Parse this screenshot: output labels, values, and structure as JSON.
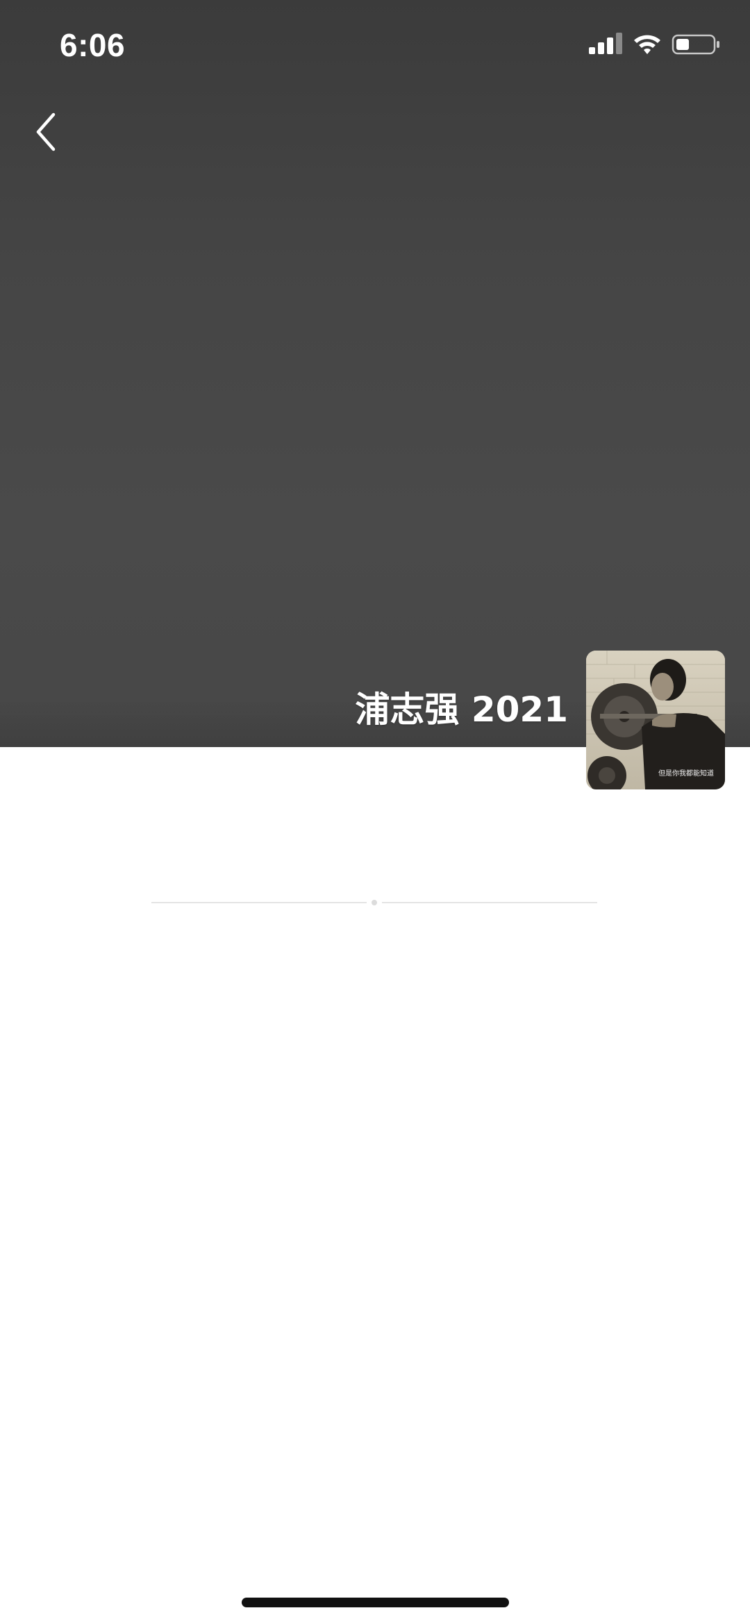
{
  "status_bar": {
    "time": "6:06",
    "icons": [
      "cellular-signal-icon",
      "wifi-icon",
      "battery-icon"
    ],
    "battery_level": 0.35
  },
  "navigation": {
    "back_icon": "chevron-left-icon"
  },
  "profile": {
    "name": "浦志强 2021",
    "avatar_caption": "但是你我都能知道"
  },
  "colors": {
    "cover_background": "#444444",
    "page_background": "#ffffff",
    "text_on_cover": "#ffffff",
    "divider": "#e4e4e4",
    "home_indicator": "#111111"
  }
}
